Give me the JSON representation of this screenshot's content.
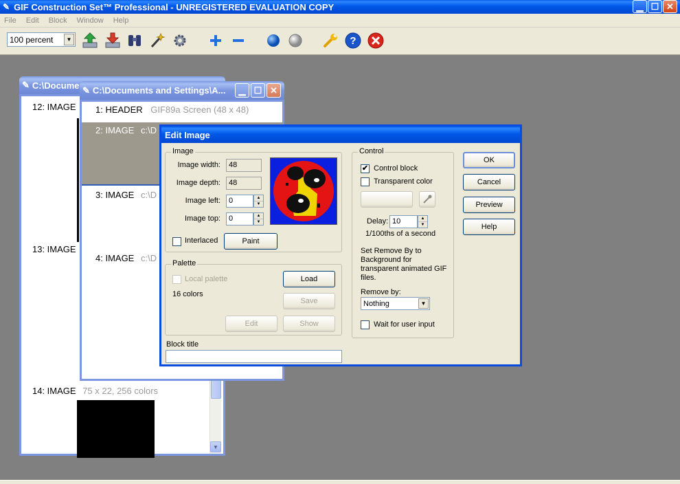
{
  "app": {
    "title": "GIF Construction Set™ Professional - UNREGISTERED EVALUATION COPY",
    "menu": [
      "File",
      "Edit",
      "Block",
      "Window",
      "Help"
    ]
  },
  "toolbar": {
    "zoom_value": "100 percent",
    "colors": {
      "accent": "#0058e6",
      "close": "#d24416"
    }
  },
  "back_window": {
    "title": "C:\\Documents",
    "items": [
      {
        "num": "12: IMAGE",
        "info": ""
      },
      {
        "num": "13: IMAGE",
        "info": ""
      },
      {
        "num": "14: IMAGE",
        "info": "75 x 22, 256 colors"
      }
    ]
  },
  "front_window": {
    "title": "C:\\Documents and Settings\\A...",
    "items": [
      {
        "num": "1: HEADER",
        "info": "GIF89a Screen (48 x 48)"
      },
      {
        "num": "2: IMAGE",
        "info": "c:\\D"
      },
      {
        "num": "3: IMAGE",
        "info": "c:\\D"
      },
      {
        "num": "4: IMAGE",
        "info": "c:\\D"
      }
    ]
  },
  "dialog": {
    "title": "Edit Image",
    "image_group": {
      "legend": "Image",
      "width_label": "Image width:",
      "width_value": "48",
      "depth_label": "Image depth:",
      "depth_value": "48",
      "left_label": "Image left:",
      "left_value": "0",
      "top_label": "Image top:",
      "top_value": "0",
      "interlaced_label": "Interlaced",
      "paint_label": "Paint"
    },
    "palette_group": {
      "legend": "Palette",
      "local_label": "Local palette",
      "colors_text": "16 colors",
      "load_label": "Load",
      "save_label": "Save",
      "edit_label": "Edit",
      "show_label": "Show"
    },
    "block_title_label": "Block title",
    "control_group": {
      "legend": "Control",
      "control_block_label": "Control block",
      "transparent_label": "Transparent color",
      "delay_label": "Delay:",
      "delay_value": "10",
      "delay_unit": "1/100ths of a second",
      "remove_note": "Set Remove By to Background for transparent animated GIF files.",
      "remove_by_label": "Remove by:",
      "remove_by_value": "Nothing",
      "wait_label": "Wait for user input"
    },
    "buttons": {
      "ok": "OK",
      "cancel": "Cancel",
      "preview": "Preview",
      "help": "Help"
    }
  }
}
